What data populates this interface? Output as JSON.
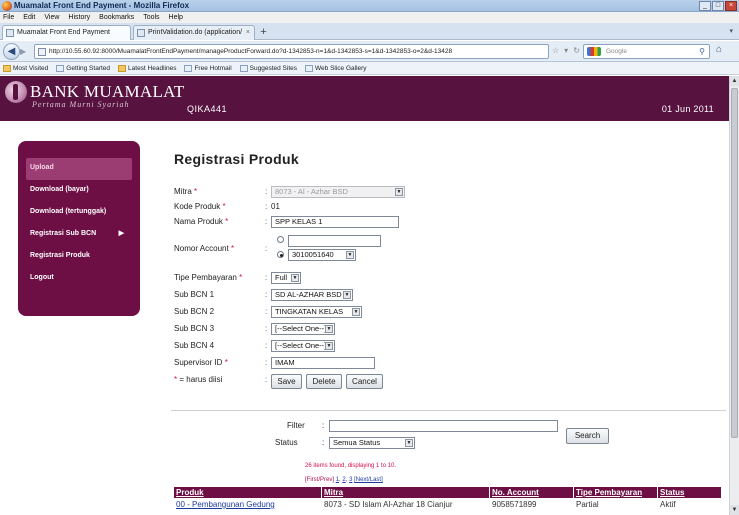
{
  "window": {
    "title": "Muamalat Front End Payment - Mozilla Firefox",
    "min": "_",
    "max": "□",
    "close": "×"
  },
  "menu": [
    "File",
    "Edit",
    "View",
    "History",
    "Bookmarks",
    "Tools",
    "Help"
  ],
  "tabs": [
    {
      "label": "Muamalat Front End Payment",
      "close": "×"
    },
    {
      "label": "PrintValidation.do (application/pdf Object)",
      "close": "×"
    }
  ],
  "newtab": "+",
  "nav": {
    "back": "◀",
    "forward": "▶",
    "url": "http://10.55.60.92:8000/MuamalatFrontEndPayment/manageProductForward.do?d-1342853-n=1&d-1342853-s=1&d-1342853-o=2&d-13428",
    "search_placeholder": "Google",
    "home": "⌂"
  },
  "bookmarks": [
    "Most Visited",
    "Getting Started",
    "Latest Headlines",
    "Free Hotmail",
    "Suggested Sites",
    "Web Slice Gallery"
  ],
  "header": {
    "bank_name": "BANK MUAMALAT",
    "tagline": "Pertama Murni Syariah",
    "user": "QIKA441",
    "date": "01 Jun 2011"
  },
  "sidebar": [
    {
      "label": "Upload",
      "active": true
    },
    {
      "label": "Download (bayar)"
    },
    {
      "label": "Download (tertunggak)"
    },
    {
      "label": "Registrasi Sub BCN",
      "arrow": "▶"
    },
    {
      "label": "Registrasi Produk"
    },
    {
      "label": "Logout"
    }
  ],
  "form": {
    "title": "Registrasi Produk",
    "mitra": {
      "label": "Mitra",
      "value": "8073 - Al - Azhar BSD"
    },
    "kode_produk": {
      "label": "Kode Produk",
      "value": "01"
    },
    "nama_produk": {
      "label": "Nama Produk",
      "value": "SPP KELAS 1"
    },
    "nomor_account": {
      "label": "Nomor Account",
      "value": "3010051640"
    },
    "tipe_pembayaran": {
      "label": "Tipe Pembayaran",
      "value": "Full"
    },
    "sub_bcn_1": {
      "label": "Sub BCN 1",
      "value": "SD AL-AZHAR BSD"
    },
    "sub_bcn_2": {
      "label": "Sub BCN 2",
      "value": "TINGKATAN KELAS"
    },
    "sub_bcn_3": {
      "label": "Sub BCN 3",
      "value": "[--Select One--]"
    },
    "sub_bcn_4": {
      "label": "Sub BCN 4",
      "value": "[--Select One--]"
    },
    "supervisor_id": {
      "label": "Supervisor ID",
      "value": "IMAM"
    },
    "required_note": "= harus diisi",
    "asterisk": "*",
    "colon": ":",
    "save": "Save",
    "delete": "Delete",
    "cancel": "Cancel"
  },
  "filter": {
    "filter_label": "Filter",
    "status_label": "Status",
    "status_value": "Semua Status",
    "search": "Search"
  },
  "results": {
    "info": "26 items found, displaying 1 to 10.",
    "pager_prefix": "[First/Prev]",
    "pages": [
      "1",
      "2",
      "3"
    ],
    "pager_suffix": "[Next/Last]"
  },
  "table": {
    "columns": [
      "Produk",
      "Mitra",
      "No. Account",
      "Tipe Pembayaran",
      "Status"
    ],
    "rows": [
      [
        "00 - Pembangunan Gedung",
        "8073 - SD Islam Al-Azhar 18 Cianjur",
        "9058571899",
        "Partial",
        "Aktif"
      ]
    ]
  }
}
